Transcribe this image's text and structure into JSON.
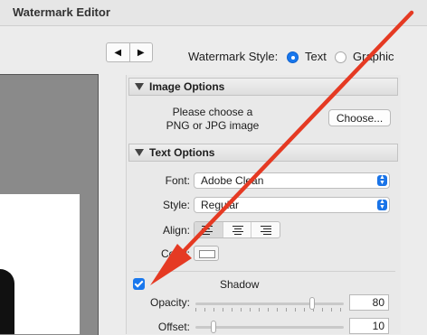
{
  "window": {
    "title": "Watermark Editor"
  },
  "nav": {
    "prev": "◀",
    "next": "▶"
  },
  "watermark_style": {
    "label": "Watermark Style:",
    "options": [
      {
        "label": "Text",
        "selected": true
      },
      {
        "label": "Graphic",
        "selected": false
      }
    ]
  },
  "image_options": {
    "title": "Image Options",
    "message_line1": "Please choose a",
    "message_line2": "PNG or JPG image",
    "choose_button": "Choose..."
  },
  "text_options": {
    "title": "Text Options",
    "font_label": "Font:",
    "font_value": "Adobe Clean",
    "style_label": "Style:",
    "style_value": "Regular",
    "align_label": "Align:",
    "align_options": [
      "left",
      "center",
      "right"
    ],
    "align_selected": "left",
    "color_label": "Color:"
  },
  "shadow": {
    "label": "Shadow",
    "checked": true,
    "opacity_label": "Opacity:",
    "opacity_value": "80",
    "offset_label": "Offset:",
    "offset_value": "10"
  },
  "colors": {
    "accent": "#1877ed",
    "annotation_arrow": "#e53a23"
  }
}
